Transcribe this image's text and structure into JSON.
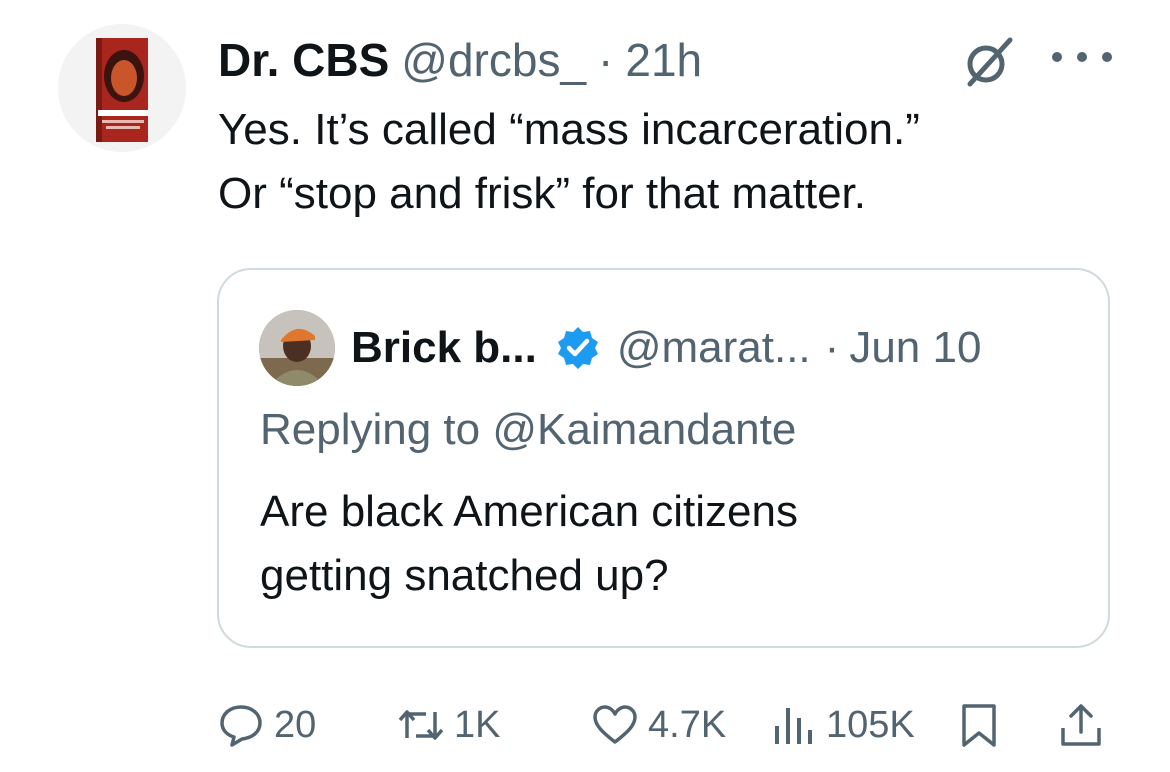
{
  "tweet": {
    "author_name": "Dr. CBS",
    "author_handle": "@drcbs_",
    "separator": "·",
    "time": "21h",
    "text_line1": "Yes. It’s called “mass incarceration.”",
    "text_line2": "Or “stop and frisk” for that matter."
  },
  "quoted_tweet": {
    "author_name": "Brick b...",
    "author_handle": "@marat...",
    "separator": "·",
    "time": "Jun 10",
    "replying_to": "Replying to @Kaimandante",
    "text_line1": "Are black American citizens",
    "text_line2": "getting snatched up?"
  },
  "actions": {
    "replies": "20",
    "reposts": "1K",
    "likes": "4.7K",
    "views": "105K"
  },
  "icons": {
    "grok": "grok-icon",
    "more": "more-icon",
    "verified": "verified-badge-icon",
    "reply": "reply-icon",
    "repost": "repost-icon",
    "like": "like-icon",
    "views": "views-icon",
    "bookmark": "bookmark-icon",
    "share": "share-icon"
  },
  "colors": {
    "text": "#0f1419",
    "secondary": "#536471",
    "border": "#cfd9de",
    "verified": "#1d9bf0"
  }
}
